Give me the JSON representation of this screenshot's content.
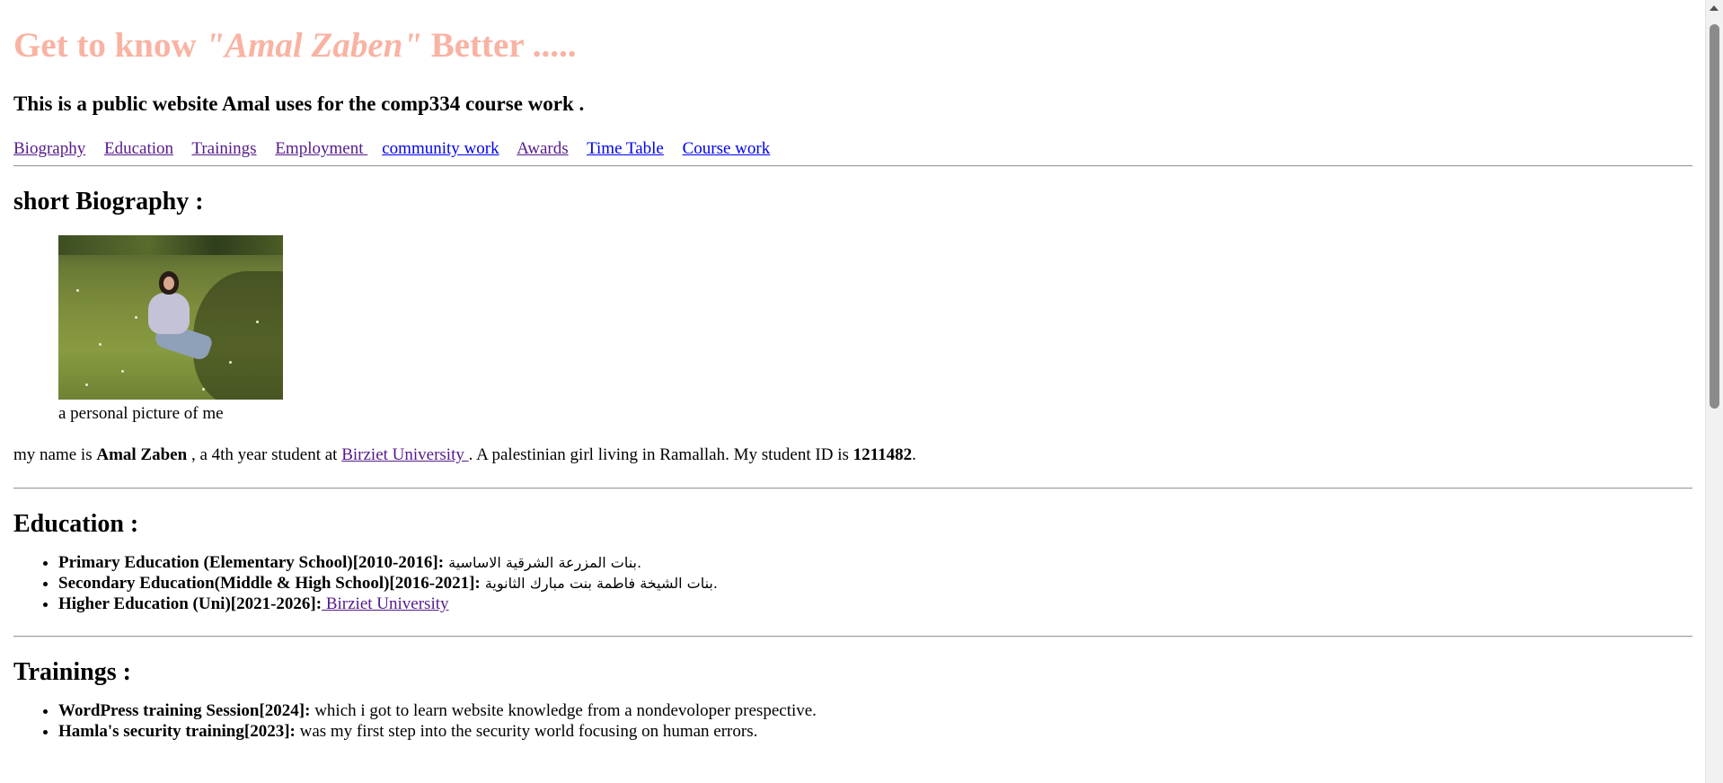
{
  "header": {
    "title_prefix": "Get to know ",
    "title_name": "\"Amal Zaben\"",
    "title_suffix": " Better .....",
    "subtitle": "This is a public website Amal uses for the comp334 course work ."
  },
  "nav": {
    "biography": "Biography",
    "education": "Education",
    "trainings": "Trainings",
    "employment": "Employment ",
    "community": "community work",
    "awards": "Awards",
    "timetable": "Time Table",
    "coursework": "Course work"
  },
  "biography": {
    "heading": "short Biography :",
    "caption": "a personal picture of me",
    "t1": "my name is ",
    "name": "Amal Zaben",
    "t2": " , a 4th year student at ",
    "university_link": "Birziet University ",
    "t3": ". A palestinian girl living in Ramallah. My student ID is ",
    "student_id": "1211482",
    "t4": "."
  },
  "education": {
    "heading": "Education :",
    "items": [
      {
        "label": "Primary Education (Elementary School)[2010-2016]:",
        "value": " بنات المزرعة الشرقية الاساسية."
      },
      {
        "label": "Secondary Education(Middle & High School)[2016-2021]:",
        "value": " بنات الشيخة فاطمة بنت مبارك الثانوية."
      },
      {
        "label": "Higher Education (Uni)[2021-2026]:",
        "link": " Birziet University"
      }
    ]
  },
  "trainings": {
    "heading": "Trainings :",
    "items": [
      {
        "label": "WordPress training Session[2024]:",
        "value": " which i got to learn website knowledge from a nondevoloper prespective."
      },
      {
        "label": "Hamla's security training[2023]:",
        "value": " was my first step into the security world focusing on human errors."
      }
    ]
  },
  "colors": {
    "title": "#f9b3a3",
    "visited_link": "#551a8b",
    "link": "#0000ee"
  },
  "icons": {
    "scroll_up": "arrow-up-icon"
  }
}
